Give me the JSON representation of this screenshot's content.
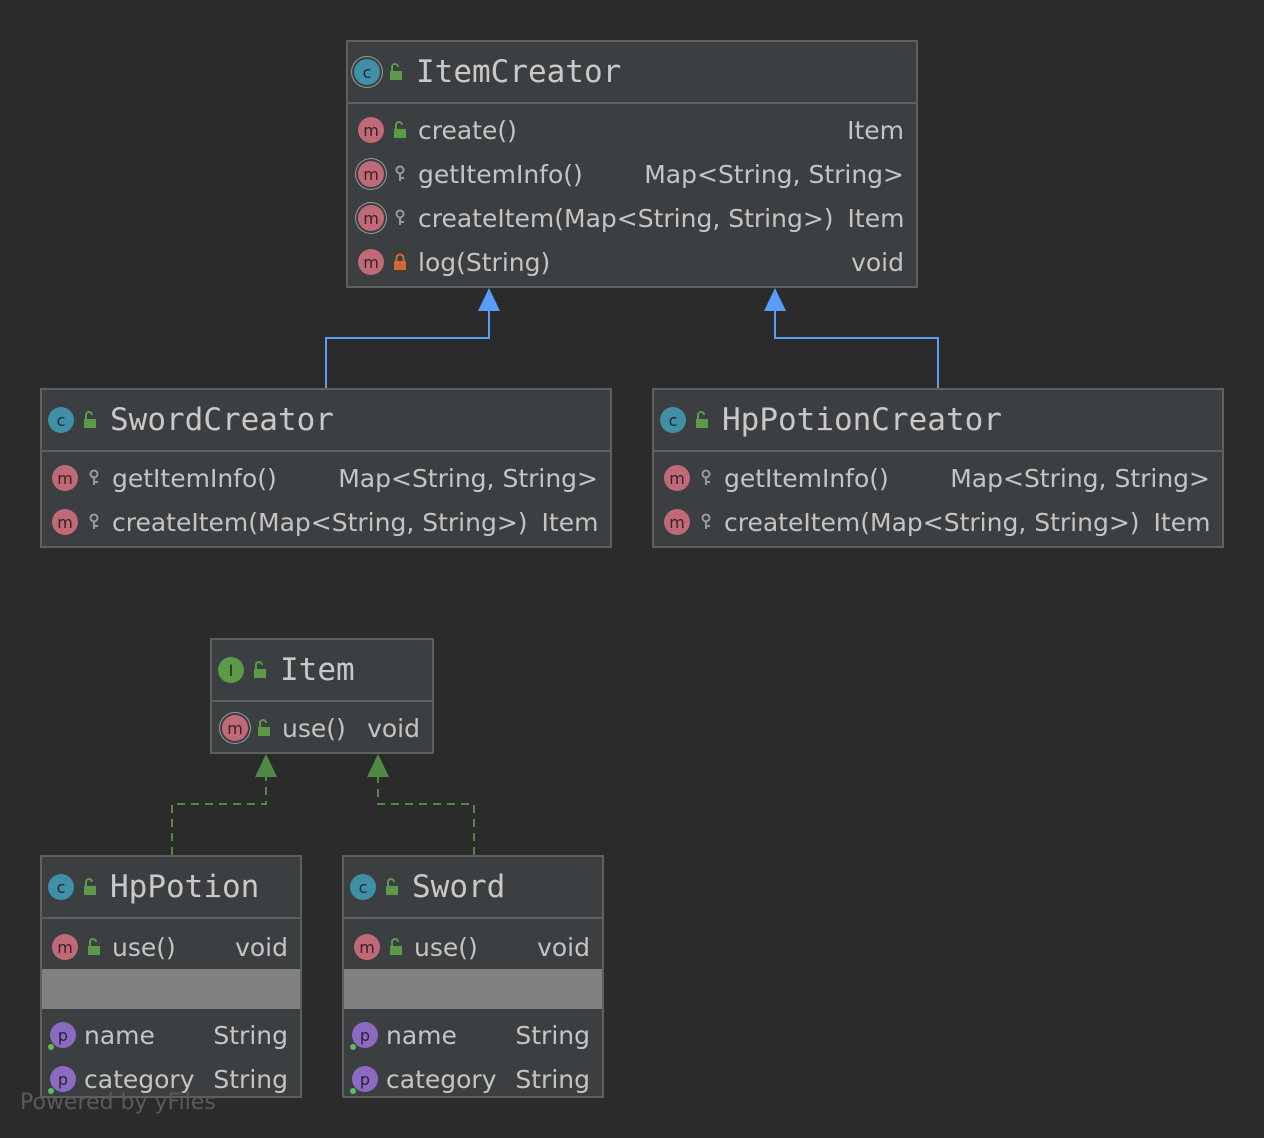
{
  "colors": {
    "background": "#2b2b2b",
    "node_fill": "#3c3f41",
    "node_border": "#5e6060",
    "extends_edge": "#589df6",
    "implements_edge": "#4f8a45"
  },
  "nodes": {
    "item_creator": {
      "title": "ItemCreator",
      "kind_icon": "class-abstract-icon",
      "visibility_icon": "public-unlock-icon",
      "methods": [
        {
          "name": "create()",
          "type": "Item",
          "abstract": false,
          "visibility": "public"
        },
        {
          "name": "getItemInfo()",
          "type": "Map<String, String>",
          "abstract": true,
          "visibility": "protected"
        },
        {
          "name": "createItem(Map<String, String>)",
          "type": "Item",
          "abstract": true,
          "visibility": "protected"
        },
        {
          "name": "log(String)",
          "type": "void",
          "abstract": false,
          "visibility": "private"
        }
      ]
    },
    "sword_creator": {
      "title": "SwordCreator",
      "kind_icon": "class-icon",
      "visibility_icon": "public-unlock-icon",
      "methods": [
        {
          "name": "getItemInfo()",
          "type": "Map<String, String>",
          "visibility": "protected"
        },
        {
          "name": "createItem(Map<String, String>)",
          "type": "Item",
          "visibility": "protected"
        }
      ]
    },
    "hppotion_creator": {
      "title": "HpPotionCreator",
      "kind_icon": "class-icon",
      "visibility_icon": "public-unlock-icon",
      "methods": [
        {
          "name": "getItemInfo()",
          "type": "Map<String, String>",
          "visibility": "protected"
        },
        {
          "name": "createItem(Map<String, String>)",
          "type": "Item",
          "visibility": "protected"
        }
      ]
    },
    "item": {
      "title": "Item",
      "kind_icon": "interface-icon",
      "visibility_icon": "public-unlock-icon",
      "methods": [
        {
          "name": "use()",
          "type": "void",
          "abstract": true,
          "visibility": "public"
        }
      ]
    },
    "hppotion": {
      "title": "HpPotion",
      "kind_icon": "class-icon",
      "visibility_icon": "public-unlock-icon",
      "methods": [
        {
          "name": "use()",
          "type": "void",
          "visibility": "public"
        }
      ],
      "fields": [
        {
          "name": "name",
          "type": "String"
        },
        {
          "name": "category",
          "type": "String"
        }
      ]
    },
    "sword": {
      "title": "Sword",
      "kind_icon": "class-icon",
      "visibility_icon": "public-unlock-icon",
      "methods": [
        {
          "name": "use()",
          "type": "void",
          "visibility": "public"
        }
      ],
      "fields": [
        {
          "name": "name",
          "type": "String"
        },
        {
          "name": "category",
          "type": "String"
        }
      ]
    }
  },
  "edges": [
    {
      "from": "SwordCreator",
      "to": "ItemCreator",
      "kind": "extends"
    },
    {
      "from": "HpPotionCreator",
      "to": "ItemCreator",
      "kind": "extends"
    },
    {
      "from": "HpPotion",
      "to": "Item",
      "kind": "implements"
    },
    {
      "from": "Sword",
      "to": "Item",
      "kind": "implements"
    }
  ],
  "watermark": "Powered by yFiles"
}
